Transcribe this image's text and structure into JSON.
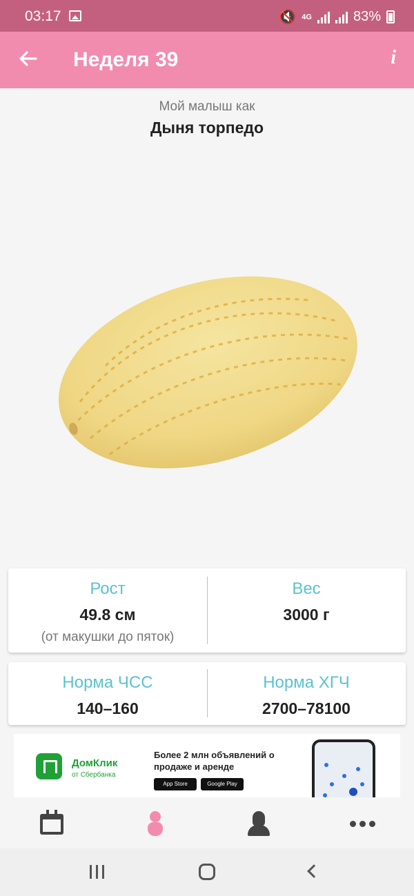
{
  "status_bar": {
    "time": "03:17",
    "network": "4G",
    "battery": "83%"
  },
  "app_bar": {
    "back_icon": "arrow-left-icon",
    "title": "Неделя 39",
    "info_label": "i"
  },
  "baby": {
    "subtitle": "Мой малыш как",
    "fruit_name": "Дыня торпедо"
  },
  "stats": {
    "height_label": "Рост",
    "height_value": "49.8 см",
    "height_note": "(от макушки до пяток)",
    "weight_label": "Вес",
    "weight_value": "3000 г",
    "hr_label": "Норма ЧСС",
    "hr_value": "140–160",
    "hcg_label": "Норма ХГЧ",
    "hcg_value": "2700–78100"
  },
  "ad": {
    "brand": "ДомКлик",
    "brand_sub": "от Сбербанка",
    "text": "Более 2 млн объявлений о продаже и аренде",
    "app_store": "App Store",
    "google_play": "Google Play"
  },
  "bottom_nav": {
    "items": [
      "calendar-icon",
      "baby-icon",
      "user-icon",
      "more-icon"
    ],
    "active": "baby-icon"
  },
  "colors": {
    "status_bar": "#c4607f",
    "app_bar": "#f28cae",
    "accent_label": "#5bc2cf",
    "melon": "#f1dc8a"
  }
}
